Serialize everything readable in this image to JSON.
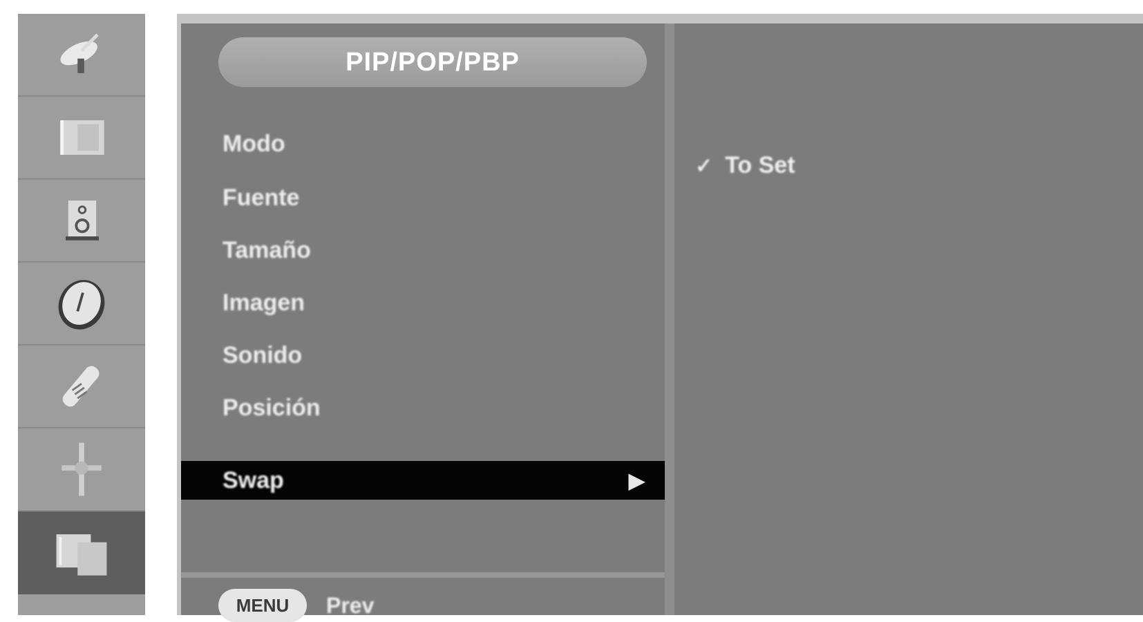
{
  "sidebar": {
    "items": [
      {
        "icon": "satellite-dish-icon",
        "active": false
      },
      {
        "icon": "picture-icon",
        "active": false
      },
      {
        "icon": "sound-icon",
        "active": false
      },
      {
        "icon": "clock-icon",
        "active": false
      },
      {
        "icon": "remote-control-icon",
        "active": false
      },
      {
        "icon": "setup-icon",
        "active": false
      },
      {
        "icon": "pip-screens-icon",
        "active": true
      }
    ]
  },
  "menu": {
    "title": "PIP/POP/PBP",
    "items": [
      "Modo",
      "Fuente",
      "Tamaño",
      "Imagen",
      "Sonido",
      "Posición"
    ],
    "selected_item": "Swap",
    "selected_arrow": "▶",
    "footer_key": "MENU",
    "footer_label": "Prev"
  },
  "options": {
    "check": "✓",
    "label": "To Set"
  },
  "colors": {
    "panel_bg": "#7c7c7c",
    "selected_bg": "#050505",
    "sidebar_bg": "#9d9d9d",
    "sidebar_active_bg": "#5e5e5e"
  }
}
